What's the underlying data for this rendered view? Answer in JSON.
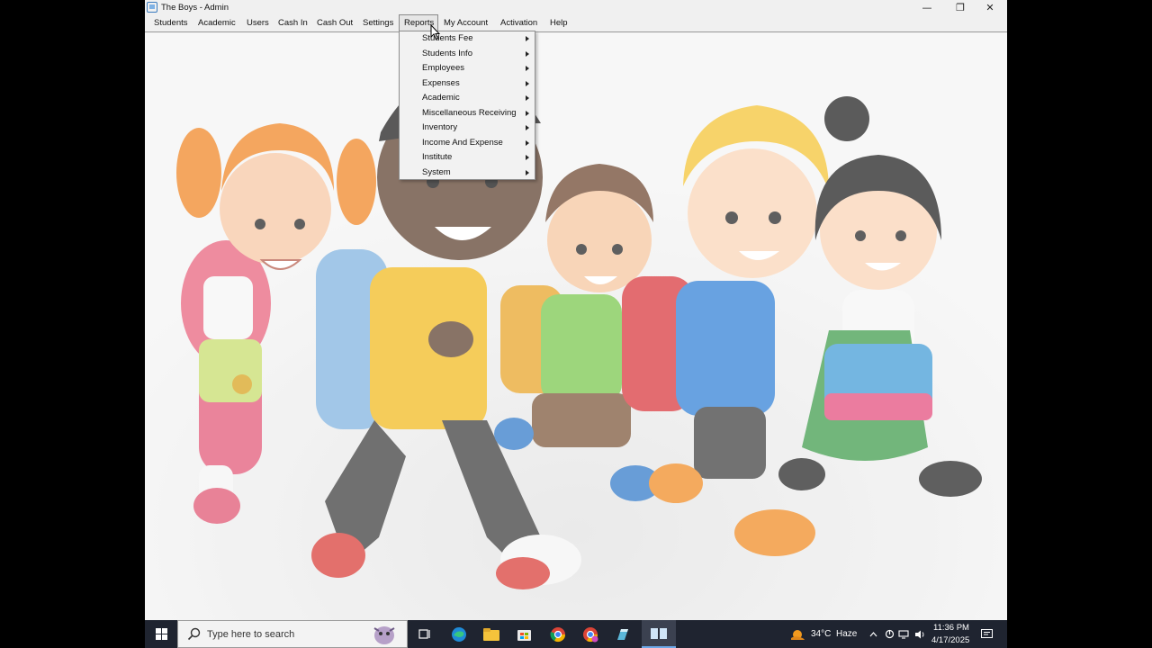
{
  "window": {
    "title": "The Boys - Admin",
    "minimize": "—",
    "restore": "❐",
    "close": "✕"
  },
  "menubar": {
    "items": [
      "Students",
      "Academic",
      "Users",
      "Cash In",
      "Cash Out",
      "Settings",
      "Reports",
      "My Account",
      "Activation",
      "Help"
    ],
    "active": "Reports"
  },
  "reports_menu": {
    "items": [
      "Students Fee",
      "Students Info",
      "Employees",
      "Expenses",
      "Academic",
      "Miscellaneous Receiving",
      "Inventory",
      "Income And Expense",
      "Institute",
      "System"
    ]
  },
  "taskbar": {
    "search_placeholder": "Type here to search",
    "weather_temp": "34°C",
    "weather_condition": "Haze",
    "time": "11:36 PM",
    "date": "4/17/2025",
    "icons": [
      "windows-start-icon",
      "task-view-icon",
      "edge-icon",
      "file-explorer-icon",
      "store-icon",
      "chrome-icon",
      "chrome-profile-icon",
      "app-icon",
      "active-app-icon"
    ]
  },
  "colors": {
    "taskbar": "#1f2430",
    "menubar": "#f0f0f0",
    "accent": "#3a7bbf"
  }
}
